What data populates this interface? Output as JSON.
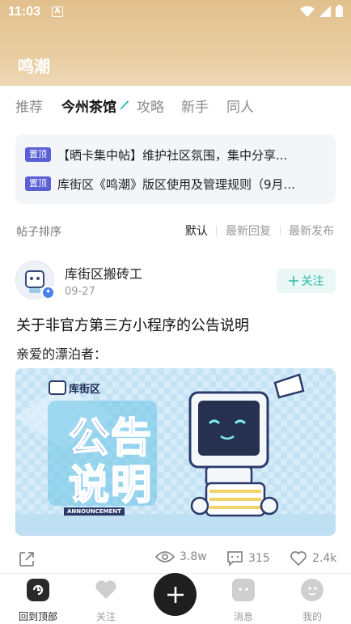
{
  "status_bar": {
    "time": "11:03",
    "app_icon": "A"
  },
  "header": {
    "title": "鸣潮"
  },
  "tabs": [
    {
      "label": "推荐",
      "active": false
    },
    {
      "label": "今州茶馆",
      "active": true
    },
    {
      "label": "攻略",
      "active": false
    },
    {
      "label": "新手",
      "active": false
    },
    {
      "label": "同人",
      "active": false
    }
  ],
  "pinned": [
    {
      "badge": "置顶",
      "text": "【晒卡集中帖】维护社区氛围，集中分享..."
    },
    {
      "badge": "置顶",
      "text": "库街区《鸣潮》版区使用及管理规则（9月..."
    }
  ],
  "sort": {
    "label": "帖子排序",
    "options": [
      "默认",
      "最新回复",
      "最新发布"
    ],
    "active_index": 0
  },
  "post": {
    "author": "库街区搬砖工",
    "date": "09-27",
    "follow_label": "关注",
    "title": "关于非官方第三方小程序的公告说明",
    "excerpt": "亲爱的漂泊者：",
    "banner": {
      "brand": "库街区",
      "headline_line1": "公告",
      "headline_line2": "说明",
      "tag": "ANNOUNCEMENT"
    },
    "stats": {
      "views": "3.8w",
      "comments": "315",
      "likes": "2.4k"
    }
  },
  "bottom_nav": [
    {
      "label": "回到顶部",
      "active": true,
      "icon": "back-to-top-icon"
    },
    {
      "label": "关注",
      "active": false,
      "icon": "heart-icon"
    },
    {
      "label": "消息",
      "active": false,
      "icon": "message-icon"
    },
    {
      "label": "我的",
      "active": false,
      "icon": "profile-icon"
    }
  ],
  "colors": {
    "header": "#e2c08e",
    "accent_teal": "#2bb9a8",
    "pin_badge": "#5a5fd6",
    "fab": "#1f1f1f"
  }
}
